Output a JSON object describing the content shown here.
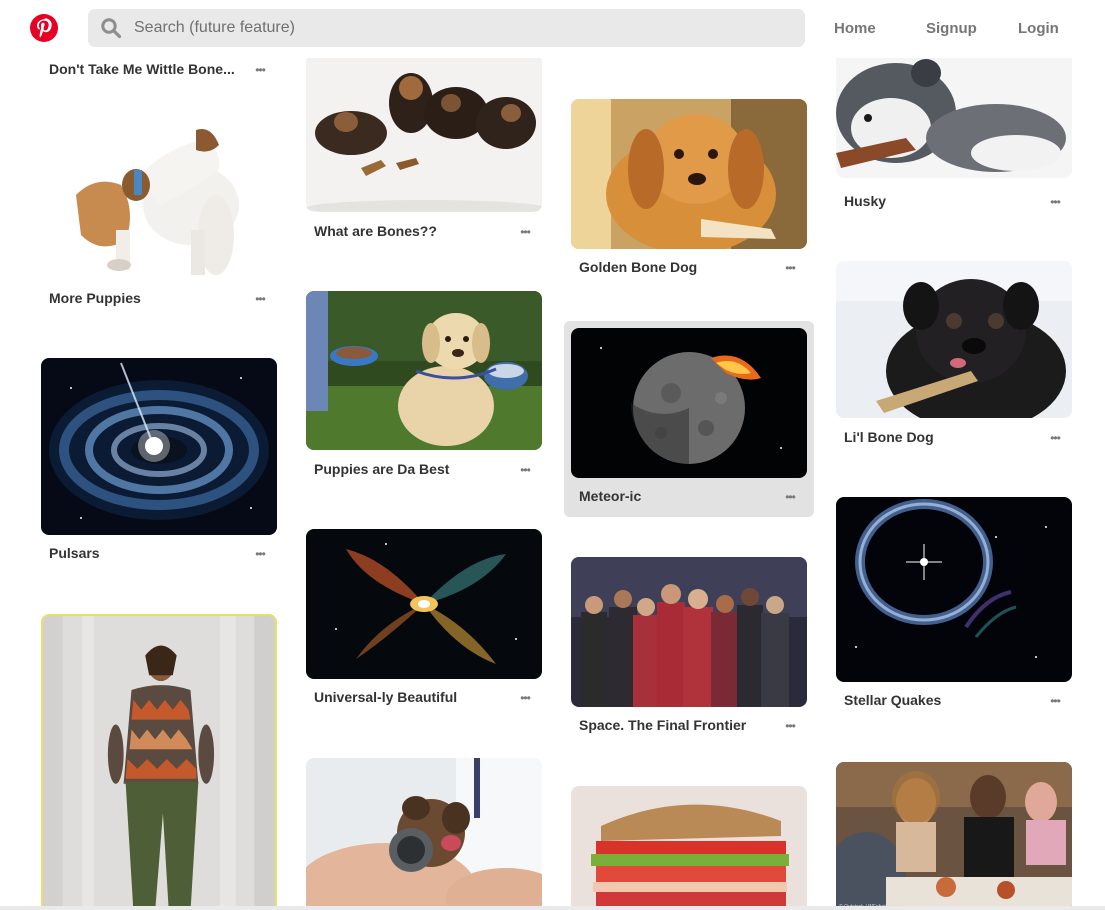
{
  "header": {
    "logo_icon": "pinterest-logo-icon",
    "brand_color": "#e60023",
    "search_placeholder": "Search (future feature)",
    "search_icon": "search-icon",
    "nav": {
      "home": "Home",
      "signup": "Signup",
      "login": "Login"
    }
  },
  "pins": [
    {
      "title": "Don't Take Me Wittle Bone...",
      "more": "•••",
      "image": "puppies-with-bone"
    },
    {
      "title": "What are Bones??",
      "more": "•••",
      "image": "yorkie-puppies-dog-biscuits"
    },
    {
      "title": "Golden Bone Dog",
      "more": "•••",
      "image": "golden-retriever-puppy"
    },
    {
      "title": "Husky",
      "more": "•••",
      "image": "husky-with-bone"
    },
    {
      "title": "More Puppies",
      "more": "•••",
      "image": "jack-russell-puppy"
    },
    {
      "title": "Puppies are Da Best",
      "more": "•••",
      "image": "labrador-puppy-on-grass"
    },
    {
      "title": "Meteor-ic",
      "more": "•••",
      "image": "meteor-impact-planet"
    },
    {
      "title": "Li'l Bone Dog",
      "more": "•••",
      "image": "black-pug-with-bone"
    },
    {
      "title": "Pulsars",
      "more": "•••",
      "image": "pulsar-space"
    },
    {
      "title": "Universal-ly Beautiful",
      "more": "•••",
      "image": "butterfly-nebula"
    },
    {
      "title": "Space. The Final Frontier",
      "more": "•••",
      "image": "star-trek-crew"
    },
    {
      "title": "Stellar Quakes",
      "more": "•••",
      "image": "stellar-quake-ring"
    },
    {
      "title": "",
      "more": "",
      "image": "fashion-woman-portrait"
    },
    {
      "title": "",
      "more": "",
      "image": "puppy-with-stethoscope"
    },
    {
      "title": "",
      "more": "",
      "image": "layered-sandwich"
    },
    {
      "title": "",
      "more": "",
      "image": "people-at-restaurant"
    }
  ],
  "image_watermark": "© Outstock / INFphoto.com"
}
